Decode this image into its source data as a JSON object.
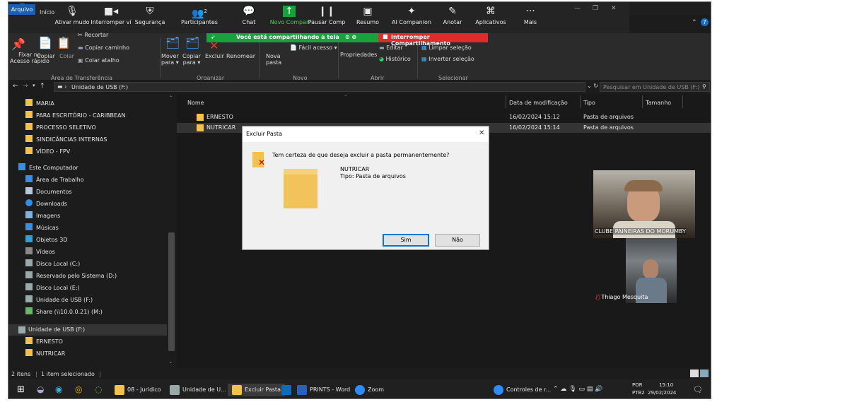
{
  "ribbon": {
    "tabs": [
      "Arquivo",
      "Início"
    ],
    "clipboard": {
      "pin": "Fixar no\nAcesso rápido",
      "copy": "Copiar",
      "paste": "Colar",
      "cut": "Recortar",
      "copy_path": "Copiar caminho",
      "paste_shortcut": "Colar atalho",
      "group": "Área de Transferência"
    },
    "organize": {
      "move": "Mover\npara ▾",
      "copy_to": "Copiar\npara ▾",
      "delete": "Excluir",
      "rename": "Renomear",
      "group": "Organizar"
    },
    "new": {
      "new_folder": "Nova\npasta",
      "easy_access": "Fácil acesso ▾",
      "group": "Novo"
    },
    "open": {
      "properties": "Propriedades",
      "edit": "Editar",
      "history": "Histórico",
      "group": "Abrir"
    },
    "select": {
      "clear": "Limpar seleção",
      "invert": "Inverter seleção",
      "group": "Selecionar"
    }
  },
  "zoom": {
    "items": [
      "Ativar mudo",
      "Interromper ví",
      "Segurança",
      "Participantes",
      "Chat",
      "Novo Compar",
      "Pausar Comp",
      "Resumo",
      "AI Companion",
      "Anotar",
      "Aplicativos",
      "Mais"
    ],
    "participants_count": "2",
    "sharing_text": "Você está compartilhando a tela",
    "stop_share": "Interromper Compartilhamento"
  },
  "address": {
    "path": "Unidade de USB (F:)",
    "search_placeholder": "Pesquisar em Unidade de USB (F:)"
  },
  "nav": {
    "quick": [
      "MARIA",
      "PARA ESCRITÓRIO - CARIBBEAN",
      "PROCESSO SELETIVO",
      "SINDICÂNCIAS INTERNAS",
      "VÍDEO - FPV"
    ],
    "computer": "Este Computador",
    "computer_items": [
      "Área de Trabalho",
      "Documentos",
      "Downloads",
      "Imagens",
      "Músicas",
      "Objetos 3D",
      "Vídeos",
      "Disco Local (C:)",
      "Reservado pelo Sistema (D:)",
      "Disco Local (E:)",
      "Unidade de USB (F:)",
      "Share (\\\\10.0.0.21) (M:)"
    ],
    "usb": "Unidade de USB (F:)",
    "usb_items": [
      "ERNESTO",
      "NUTRICAR"
    ]
  },
  "list": {
    "headers": [
      "Nome",
      "Data de modificação",
      "Tipo",
      "Tamanho"
    ],
    "rows": [
      {
        "name": "ERNESTO",
        "date": "16/02/2024 15:12",
        "type": "Pasta de arquivos"
      },
      {
        "name": "NUTRICAR",
        "date": "16/02/2024 15:14",
        "type": "Pasta de arquivos"
      }
    ]
  },
  "dialog": {
    "title": "Excluir Pasta",
    "question": "Tem certeza de que deseja excluir a pasta permanentemente?",
    "item_name": "NUTRICAR",
    "item_type": "Tipo: Pasta de arquivos",
    "yes": "Sim",
    "no": "Não"
  },
  "participants": [
    {
      "name": "CLUBE PAINEIRAS DO MORUMBY"
    },
    {
      "name": "Thiago Mesquita"
    }
  ],
  "status": {
    "count": "2 itens",
    "selected": "1 item selecionado"
  },
  "taskbar": {
    "apps": [
      "08 - Juridico",
      "Unidade de U...",
      "Excluir Pasta",
      "PRINTS - Word",
      "Zoom",
      "Controles de r..."
    ],
    "lang": "POR",
    "layout": "PTB2",
    "time": "15:10",
    "date": "29/02/2024"
  },
  "colors": {
    "accent": "#0078d7",
    "share_green": "#17a33b",
    "share_red": "#e02b2b",
    "folder": "#f4c24b"
  }
}
